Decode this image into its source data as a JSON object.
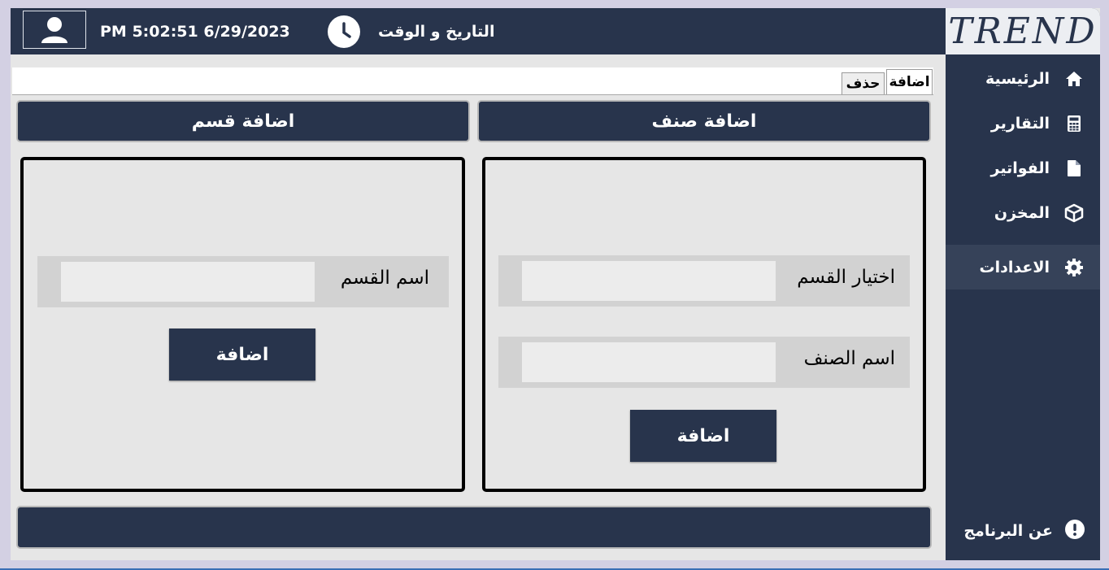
{
  "header": {
    "datetime_value": "PM 5:02:51 6/29/2023",
    "datetime_label": "التاريخ و الوقت",
    "logo_text": "TREND"
  },
  "sidebar": {
    "items": [
      {
        "label": "الرئيسية",
        "icon": "home-icon"
      },
      {
        "label": "التقارير",
        "icon": "calculator-icon"
      },
      {
        "label": "الفواتير",
        "icon": "file-icon"
      },
      {
        "label": "المخزن",
        "icon": "box-icon"
      },
      {
        "label": "الاعدادات",
        "icon": "gear-icon"
      }
    ],
    "active_index": 4,
    "about_label": "عن البرنامج"
  },
  "tabs": {
    "add": "اضافة",
    "delete": "حذف"
  },
  "add_item": {
    "header": "اضافة صنف",
    "category_label": "اختيار القسم",
    "category_value": "",
    "name_label": "اسم الصنف",
    "name_value": "",
    "button": "اضافة"
  },
  "add_category": {
    "header": "اضافة قسم",
    "name_label": "اسم القسم",
    "name_value": "",
    "button": "اضافة"
  },
  "colors": {
    "navy": "#28344c",
    "panel_bg": "#e6e6e6",
    "field_row_bg": "#d2d2d2"
  }
}
